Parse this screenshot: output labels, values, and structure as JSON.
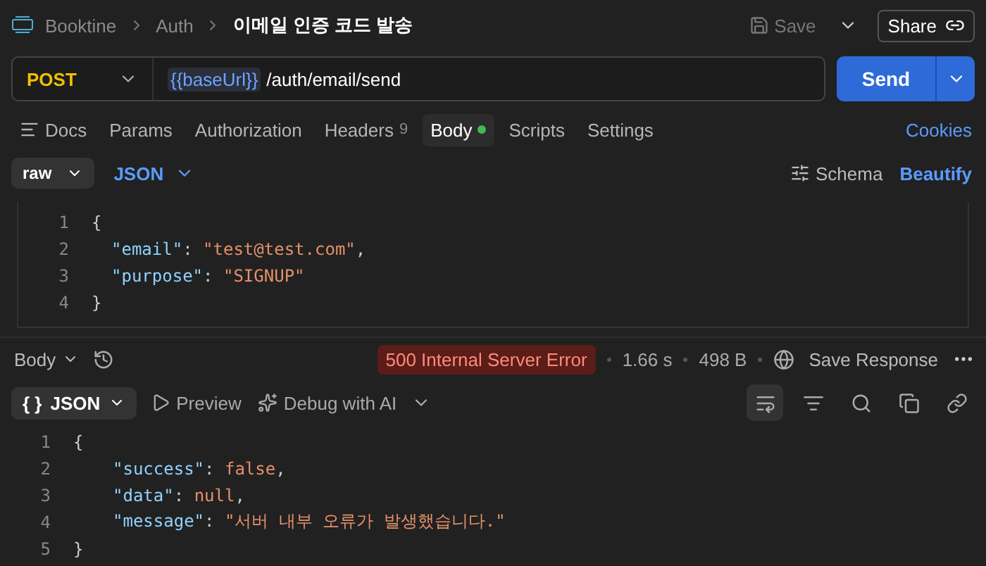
{
  "header": {
    "breadcrumb": [
      "Booktine",
      "Auth"
    ],
    "title": "이메일 인증 코드 발송",
    "save": "Save",
    "share": "Share"
  },
  "request": {
    "method": "POST",
    "url_variable": "{{baseUrl}}",
    "url_path": "/auth/email/send",
    "send": "Send"
  },
  "tabs": [
    {
      "label": "Docs",
      "selected": false
    },
    {
      "label": "Params",
      "selected": false
    },
    {
      "label": "Authorization",
      "selected": false
    },
    {
      "label": "Headers",
      "badge": "9",
      "selected": false
    },
    {
      "label": "Body",
      "dot": true,
      "selected": true
    },
    {
      "label": "Scripts",
      "selected": false
    },
    {
      "label": "Settings",
      "selected": false
    }
  ],
  "cookies": "Cookies",
  "body_toolbar": {
    "mode": "raw",
    "format": "JSON",
    "schema": "Schema",
    "beautify": "Beautify"
  },
  "request_body": [
    {
      "number": "1",
      "tokens": [
        {
          "kind": "punct",
          "text": "{"
        }
      ]
    },
    {
      "number": "2",
      "tokens": [
        {
          "kind": "key",
          "text": "\"email\""
        },
        {
          "kind": "punct",
          "text": ": "
        },
        {
          "kind": "string",
          "text": "\"test@test.com\""
        },
        {
          "kind": "punct",
          "text": ","
        }
      ]
    },
    {
      "number": "3",
      "tokens": [
        {
          "kind": "key",
          "text": "\"purpose\""
        },
        {
          "kind": "punct",
          "text": ": "
        },
        {
          "kind": "string",
          "text": "\"SIGNUP\""
        }
      ]
    },
    {
      "number": "4",
      "tokens": [
        {
          "kind": "punct",
          "text": "}"
        }
      ]
    }
  ],
  "response_bar": {
    "view": "Body",
    "status": "500 Internal Server Error",
    "time": "1.66 s",
    "size": "498 B",
    "save_response": "Save Response"
  },
  "response_toolbar": {
    "braces": "{ }",
    "format": "JSON",
    "preview": "Preview",
    "debug": "Debug with AI",
    "word_wrap_on": true
  },
  "response_body": [
    {
      "number": "1",
      "tokens": [
        {
          "kind": "punct",
          "text": "{"
        }
      ]
    },
    {
      "number": "2",
      "tokens": [
        {
          "kind": "key",
          "text": "\"success\""
        },
        {
          "kind": "punct",
          "text": ": "
        },
        {
          "kind": "literal",
          "text": "false"
        },
        {
          "kind": "punct",
          "text": ","
        }
      ]
    },
    {
      "number": "3",
      "tokens": [
        {
          "kind": "key",
          "text": "\"data\""
        },
        {
          "kind": "punct",
          "text": ": "
        },
        {
          "kind": "literal",
          "text": "null"
        },
        {
          "kind": "punct",
          "text": ","
        }
      ]
    },
    {
      "number": "4",
      "tokens": [
        {
          "kind": "key",
          "text": "\"message\""
        },
        {
          "kind": "punct",
          "text": ": "
        },
        {
          "kind": "string",
          "text": "\"서버 내부 오류가 발생했습니다.\""
        }
      ]
    },
    {
      "number": "5",
      "tokens": [
        {
          "kind": "punct",
          "text": "}"
        }
      ]
    }
  ]
}
